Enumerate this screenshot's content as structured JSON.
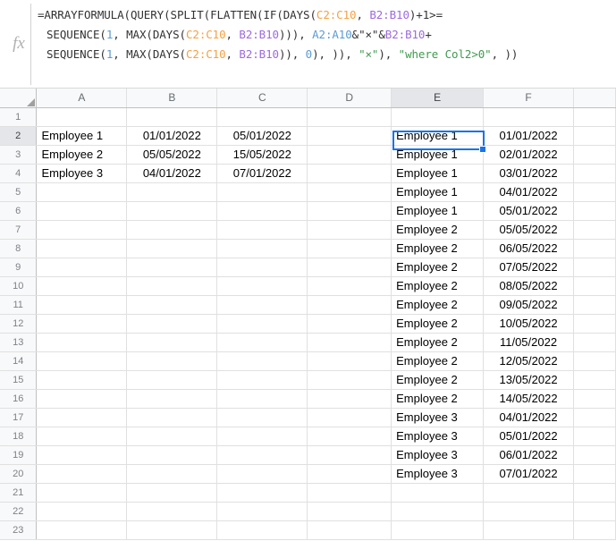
{
  "formula_bar": {
    "fx_label": "fx",
    "lines": [
      [
        {
          "t": "=ARRAYFORMULA(QUERY(SPLIT(FLATTEN(IF(DAYS(",
          "c": "plain"
        },
        {
          "t": "C2:C10",
          "c": "orange"
        },
        {
          "t": ", ",
          "c": "plain"
        },
        {
          "t": "B2:B10",
          "c": "purple"
        },
        {
          "t": ")+1>=",
          "c": "plain"
        }
      ],
      [
        {
          "t": "SEQUENCE(",
          "c": "plain"
        },
        {
          "t": "1",
          "c": "num"
        },
        {
          "t": ", MAX(DAYS(",
          "c": "plain"
        },
        {
          "t": "C2:C10",
          "c": "orange"
        },
        {
          "t": ", ",
          "c": "plain"
        },
        {
          "t": "B2:B10",
          "c": "purple"
        },
        {
          "t": "))), ",
          "c": "plain"
        },
        {
          "t": "A2:A10",
          "c": "blue"
        },
        {
          "t": "&\"×\"&",
          "c": "plain"
        },
        {
          "t": "B2:B10",
          "c": "purple"
        },
        {
          "t": "+",
          "c": "plain"
        }
      ],
      [
        {
          "t": "SEQUENCE(",
          "c": "plain"
        },
        {
          "t": "1",
          "c": "num"
        },
        {
          "t": ", MAX(DAYS(",
          "c": "plain"
        },
        {
          "t": "C2:C10",
          "c": "orange"
        },
        {
          "t": ", ",
          "c": "plain"
        },
        {
          "t": "B2:B10",
          "c": "purple"
        },
        {
          "t": ")), ",
          "c": "plain"
        },
        {
          "t": "0",
          "c": "num"
        },
        {
          "t": "), )), ",
          "c": "plain"
        },
        {
          "t": "\"×\"",
          "c": "str"
        },
        {
          "t": "), ",
          "c": "plain"
        },
        {
          "t": "\"where Col2>0\"",
          "c": "str"
        },
        {
          "t": ", ))",
          "c": "plain"
        }
      ]
    ],
    "plain_text": "=ARRAYFORMULA(QUERY(SPLIT(FLATTEN(IF(DAYS(C2:C10, B2:B10)+1>= SEQUENCE(1, MAX(DAYS(C2:C10, B2:B10))), A2:A10&\"×\"&B2:B10+ SEQUENCE(1, MAX(DAYS(C2:C10, B2:B10)), 0), )), \"×\"), \"where Col2>0\", ))"
  },
  "grid": {
    "columns": [
      {
        "label": "A",
        "width": 101,
        "active": false
      },
      {
        "label": "B",
        "width": 101,
        "active": false
      },
      {
        "label": "C",
        "width": 101,
        "active": false
      },
      {
        "label": "D",
        "width": 94,
        "active": false
      },
      {
        "label": "E",
        "width": 103,
        "active": true
      },
      {
        "label": "F",
        "width": 101,
        "active": false
      },
      {
        "label": "",
        "width": 47,
        "active": false
      }
    ],
    "active_cell": "E2",
    "rows": [
      {
        "n": "1",
        "active": false,
        "A": "",
        "B": "",
        "C": "",
        "D": "",
        "E": "",
        "F": ""
      },
      {
        "n": "2",
        "active": true,
        "A": "Employee 1",
        "B": "01/01/2022",
        "C": "05/01/2022",
        "D": "",
        "E": "Employee 1",
        "F": "01/01/2022"
      },
      {
        "n": "3",
        "active": false,
        "A": "Employee 2",
        "B": "05/05/2022",
        "C": "15/05/2022",
        "D": "",
        "E": "Employee 1",
        "F": "02/01/2022"
      },
      {
        "n": "4",
        "active": false,
        "A": "Employee 3",
        "B": "04/01/2022",
        "C": "07/01/2022",
        "D": "",
        "E": "Employee 1",
        "F": "03/01/2022"
      },
      {
        "n": "5",
        "active": false,
        "A": "",
        "B": "",
        "C": "",
        "D": "",
        "E": "Employee 1",
        "F": "04/01/2022"
      },
      {
        "n": "6",
        "active": false,
        "A": "",
        "B": "",
        "C": "",
        "D": "",
        "E": "Employee 1",
        "F": "05/01/2022"
      },
      {
        "n": "7",
        "active": false,
        "A": "",
        "B": "",
        "C": "",
        "D": "",
        "E": "Employee 2",
        "F": "05/05/2022"
      },
      {
        "n": "8",
        "active": false,
        "A": "",
        "B": "",
        "C": "",
        "D": "",
        "E": "Employee 2",
        "F": "06/05/2022"
      },
      {
        "n": "9",
        "active": false,
        "A": "",
        "B": "",
        "C": "",
        "D": "",
        "E": "Employee 2",
        "F": "07/05/2022"
      },
      {
        "n": "10",
        "active": false,
        "A": "",
        "B": "",
        "C": "",
        "D": "",
        "E": "Employee 2",
        "F": "08/05/2022"
      },
      {
        "n": "11",
        "active": false,
        "A": "",
        "B": "",
        "C": "",
        "D": "",
        "E": "Employee 2",
        "F": "09/05/2022"
      },
      {
        "n": "12",
        "active": false,
        "A": "",
        "B": "",
        "C": "",
        "D": "",
        "E": "Employee 2",
        "F": "10/05/2022"
      },
      {
        "n": "13",
        "active": false,
        "A": "",
        "B": "",
        "C": "",
        "D": "",
        "E": "Employee 2",
        "F": "11/05/2022"
      },
      {
        "n": "14",
        "active": false,
        "A": "",
        "B": "",
        "C": "",
        "D": "",
        "E": "Employee 2",
        "F": "12/05/2022"
      },
      {
        "n": "15",
        "active": false,
        "A": "",
        "B": "",
        "C": "",
        "D": "",
        "E": "Employee 2",
        "F": "13/05/2022"
      },
      {
        "n": "16",
        "active": false,
        "A": "",
        "B": "",
        "C": "",
        "D": "",
        "E": "Employee 2",
        "F": "14/05/2022"
      },
      {
        "n": "17",
        "active": false,
        "A": "",
        "B": "",
        "C": "",
        "D": "",
        "E": "Employee 3",
        "F": "04/01/2022"
      },
      {
        "n": "18",
        "active": false,
        "A": "",
        "B": "",
        "C": "",
        "D": "",
        "E": "Employee 3",
        "F": "05/01/2022"
      },
      {
        "n": "19",
        "active": false,
        "A": "",
        "B": "",
        "C": "",
        "D": "",
        "E": "Employee 3",
        "F": "06/01/2022"
      },
      {
        "n": "20",
        "active": false,
        "A": "",
        "B": "",
        "C": "",
        "D": "",
        "E": "Employee 3",
        "F": "07/01/2022"
      },
      {
        "n": "21",
        "active": false,
        "A": "",
        "B": "",
        "C": "",
        "D": "",
        "E": "",
        "F": ""
      },
      {
        "n": "22",
        "active": false,
        "A": "",
        "B": "",
        "C": "",
        "D": "",
        "E": "",
        "F": ""
      },
      {
        "n": "23",
        "active": false,
        "A": "",
        "B": "",
        "C": "",
        "D": "",
        "E": "",
        "F": ""
      }
    ],
    "alignment": {
      "A": "left",
      "B": "center",
      "C": "center",
      "D": "left",
      "E": "left",
      "F": "center"
    }
  },
  "colors": {
    "selection": "#1a73e8",
    "header_bg": "#f8f9fa",
    "header_active_bg": "#e4e6e9",
    "gridline": "#e0e0e0",
    "ref_orange": "#f5a142",
    "ref_purple": "#9c6ade",
    "ref_blue": "#5b9bd5",
    "string_green": "#3f9a4f"
  }
}
